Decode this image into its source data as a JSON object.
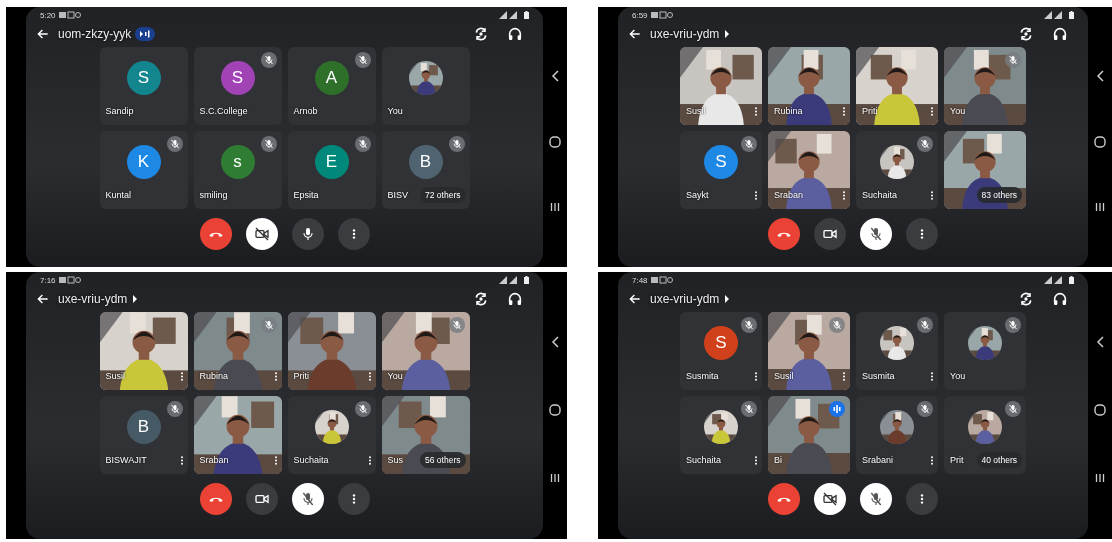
{
  "screens": [
    {
      "status_time": "5:20",
      "meeting_code": "uom-zkzy-yyk",
      "code_speaking": true,
      "camera_on": false,
      "mic_on": true,
      "tiles": [
        {
          "name": "Sandip",
          "kind": "avatar",
          "letter": "S",
          "color": "#12858f",
          "muted": false,
          "menu": false
        },
        {
          "name": "S.C.College",
          "kind": "avatar",
          "letter": "S",
          "color": "#a142b5",
          "muted": true,
          "menu": false
        },
        {
          "name": "Arnob",
          "kind": "avatar",
          "letter": "A",
          "color": "#2e6f2a",
          "muted": true,
          "menu": false
        },
        {
          "name": "You",
          "muted": false,
          "menu": false
        },
        {
          "name": "Kuntal",
          "kind": "avatar",
          "letter": "K",
          "color": "#1e88e5",
          "muted": true,
          "menu": false
        },
        {
          "name": "smiling",
          "kind": "avatar",
          "letter": "s",
          "color": "#2e7d32",
          "muted": true,
          "menu": false
        },
        {
          "name": "Epsita",
          "kind": "avatar",
          "letter": "E",
          "color": "#00897b",
          "muted": true,
          "menu": false
        },
        {
          "name": "BISV",
          "kind": "avatar",
          "letter": "B",
          "color": "#4f6470",
          "muted": true,
          "menu": false,
          "others": "72 others"
        }
      ]
    },
    {
      "status_time": "6:59",
      "meeting_code": "uxe-vriu-ydm",
      "code_speaking": false,
      "camera_on": true,
      "mic_on": false,
      "tiles": [
        {
          "name": "Susil",
          "kind": "video",
          "muted": false,
          "menu": true
        },
        {
          "name": "Rubina",
          "kind": "video",
          "muted": false,
          "menu": true
        },
        {
          "name": "Priti",
          "kind": "video",
          "muted": false,
          "menu": true
        },
        {
          "name": "You",
          "kind": "video",
          "muted": true,
          "menu": false
        },
        {
          "name": "Saykt",
          "kind": "avatar",
          "letter": "S",
          "color": "#1e88e5",
          "muted": true,
          "menu": true
        },
        {
          "name": "Sraban",
          "kind": "video",
          "muted": false,
          "menu": true
        },
        {
          "name": "Suchaita",
          "muted": true,
          "menu": true
        },
        {
          "kind": "video",
          "muted": false,
          "menu": false,
          "others": "83 others"
        }
      ]
    },
    {
      "status_time": "7:16",
      "meeting_code": "uxe-vriu-ydm",
      "code_speaking": false,
      "camera_on": true,
      "mic_on": false,
      "tiles": [
        {
          "name": "Susil",
          "kind": "video",
          "muted": false,
          "menu": true
        },
        {
          "name": "Rubina",
          "kind": "video",
          "muted": true,
          "menu": true
        },
        {
          "name": "Priti",
          "kind": "video",
          "muted": false,
          "menu": true
        },
        {
          "name": "You",
          "kind": "video",
          "muted": true,
          "menu": false
        },
        {
          "name": "BISWAJIT",
          "kind": "avatar",
          "letter": "B",
          "color": "#455a64",
          "muted": true,
          "menu": true
        },
        {
          "name": "Sraban",
          "kind": "video",
          "muted": false,
          "menu": true
        },
        {
          "name": "Suchaita",
          "muted": true,
          "menu": true
        },
        {
          "name": "Sus",
          "kind": "video",
          "muted": false,
          "menu": false,
          "others": "56 others"
        }
      ]
    },
    {
      "status_time": "7:48",
      "meeting_code": "uxe-vriu-ydm",
      "code_speaking": false,
      "camera_on": false,
      "mic_on": false,
      "tiles": [
        {
          "name": "Susmita",
          "kind": "avatar",
          "letter": "S",
          "color": "#d0401a",
          "muted": true,
          "menu": true
        },
        {
          "name": "Susil",
          "kind": "video",
          "muted": true,
          "menu": true
        },
        {
          "name": "Susmita",
          "muted": true,
          "menu": true
        },
        {
          "name": "You",
          "muted": true,
          "menu": false
        },
        {
          "name": "Suchaita",
          "muted": true,
          "menu": true
        },
        {
          "name": "Bi",
          "kind": "video",
          "muted": false,
          "speaking": true,
          "menu": false
        },
        {
          "name": "Srabani",
          "muted": true,
          "menu": true
        },
        {
          "name": "Prit",
          "muted": true,
          "menu": false,
          "others": "40 others"
        }
      ]
    }
  ]
}
